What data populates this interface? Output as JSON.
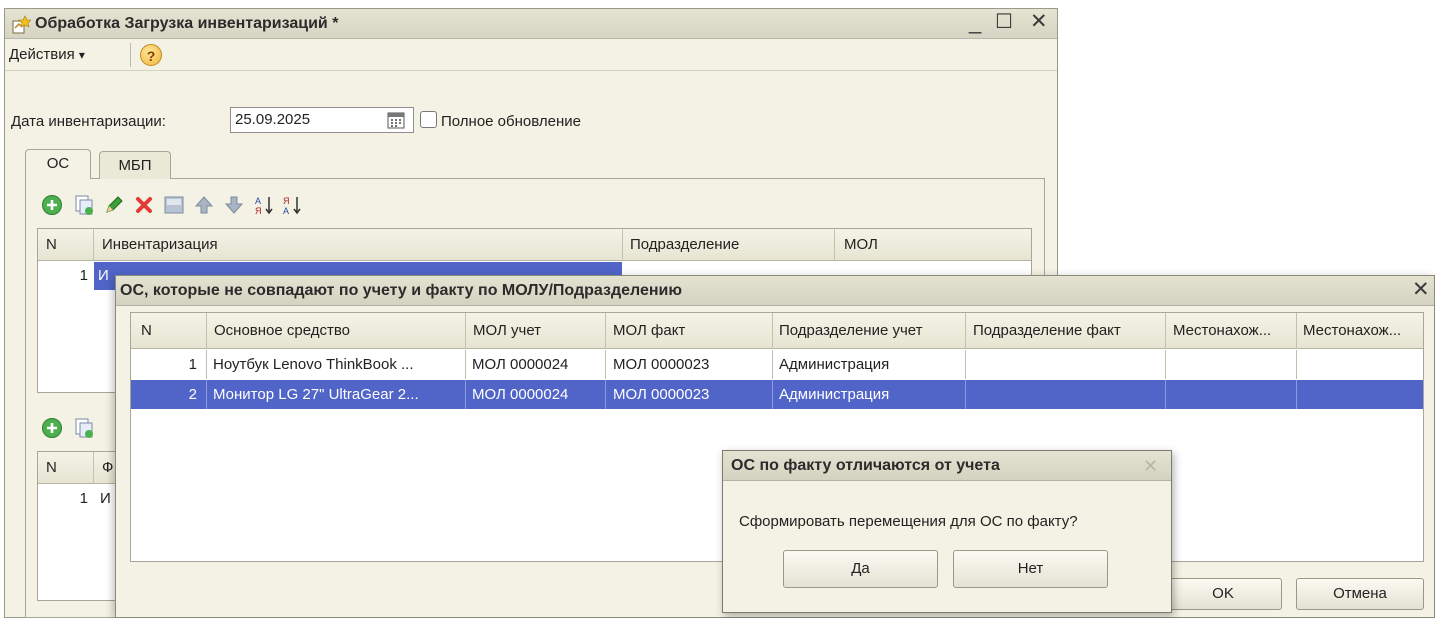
{
  "colors": {
    "selection": "#5165c9",
    "window_bg": "#f4f2e4",
    "add_icon": "#4caf50",
    "delete_icon": "#e53935"
  },
  "main_window": {
    "title": "Обработка Загрузка инвентаризаций *",
    "controls": {
      "minimize": "_",
      "maximize": "☐",
      "close": "✕"
    },
    "menu": {
      "actions": "Действия",
      "dropdown_arrow": "▾",
      "help": "?"
    },
    "date_label": "Дата инвентаризации:",
    "date_value": "25.09.2025",
    "full_update_label": "Полное обновление",
    "tabs": [
      "ОС",
      "МБП"
    ],
    "upper_table": {
      "columns": [
        "N",
        "Инвентаризация",
        "Подразделение",
        "МОЛ"
      ],
      "rows": [
        {
          "n": "1",
          "inventory": "И"
        }
      ]
    },
    "lower_table": {
      "columns": [
        "N",
        "Ф"
      ],
      "rows": [
        {
          "n": "1",
          "value": "И"
        }
      ]
    }
  },
  "mismatch_window": {
    "title": "ОС, которые не совпадают по учету и факту по МОЛУ/Подразделению",
    "close": "✕",
    "columns": [
      "N",
      "Основное средство",
      "МОЛ учет",
      "МОЛ факт",
      "Подразделение учет",
      "Подразделение факт",
      "Местонахож...",
      "Местонахож..."
    ],
    "rows": [
      {
        "n": "1",
        "asset": "Ноутбук Lenovo ThinkBook ...",
        "mol_account": "МОЛ 0000024",
        "mol_fact": "МОЛ 0000023",
        "dept_account": "Администрация",
        "dept_fact": "",
        "loc1": "",
        "loc2": ""
      },
      {
        "n": "2",
        "asset": "Монитор LG 27\" UltraGear 2...",
        "mol_account": "МОЛ 0000024",
        "mol_fact": "МОЛ 0000023",
        "dept_account": "Администрация",
        "dept_fact": "",
        "loc1": "",
        "loc2": ""
      }
    ],
    "ok_label": "OK",
    "cancel_label": "Отмена"
  },
  "confirm_dialog": {
    "title": "ОС по факту отличаются от учета",
    "close": "✕",
    "message": "Сформировать перемещения для ОС по факту?",
    "yes_label": "Да",
    "no_label": "Нет"
  }
}
